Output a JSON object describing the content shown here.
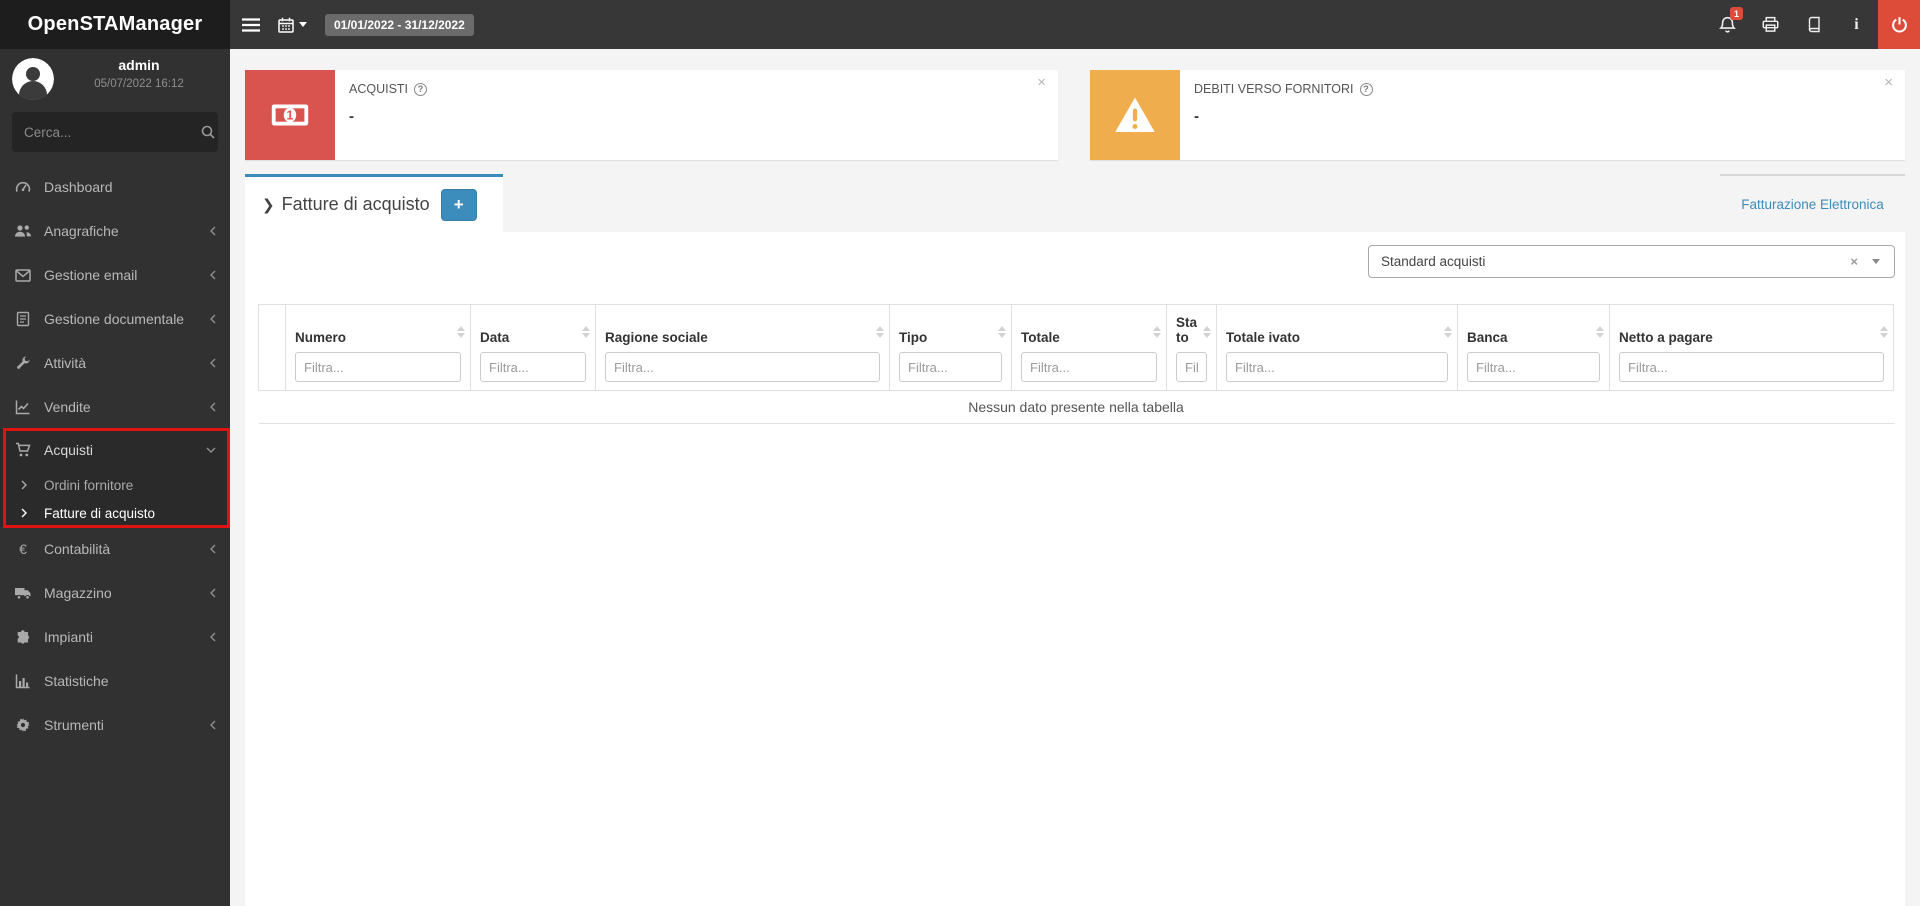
{
  "app": {
    "title": "OpenSTAManager"
  },
  "topbar": {
    "date_range": "01/01/2022 - 31/12/2022",
    "notification_count": "1"
  },
  "user": {
    "name": "admin",
    "datetime": "05/07/2022 16:12"
  },
  "search": {
    "placeholder": "Cerca..."
  },
  "sidebar": {
    "items": [
      {
        "label": "Dashboard",
        "icon": "dashboard-icon",
        "chevron": "none"
      },
      {
        "label": "Anagrafiche",
        "icon": "users-icon",
        "chevron": "collapsed"
      },
      {
        "label": "Gestione email",
        "icon": "envelope-icon",
        "chevron": "collapsed"
      },
      {
        "label": "Gestione documentale",
        "icon": "document-icon",
        "chevron": "collapsed"
      },
      {
        "label": "Attività",
        "icon": "wrench-icon",
        "chevron": "collapsed"
      },
      {
        "label": "Vendite",
        "icon": "chart-line-icon",
        "chevron": "collapsed"
      },
      {
        "label": "Acquisti",
        "icon": "cart-icon",
        "chevron": "expanded",
        "highlighted": true,
        "children": [
          {
            "label": "Ordini fornitore",
            "active": false
          },
          {
            "label": "Fatture di acquisto",
            "active": true
          }
        ]
      },
      {
        "label": "Contabilità",
        "icon": "euro-icon",
        "chevron": "collapsed"
      },
      {
        "label": "Magazzino",
        "icon": "truck-icon",
        "chevron": "collapsed"
      },
      {
        "label": "Impianti",
        "icon": "puzzle-icon",
        "chevron": "collapsed"
      },
      {
        "label": "Statistiche",
        "icon": "bar-chart-icon",
        "chevron": "none"
      },
      {
        "label": "Strumenti",
        "icon": "gear-icon",
        "chevron": "collapsed"
      }
    ]
  },
  "infoboxes": [
    {
      "label": "ACQUISTI",
      "value": "-",
      "icon": "money-bill-icon",
      "color": "#d9534f"
    },
    {
      "label": "DEBITI VERSO FORNITORI",
      "value": "-",
      "icon": "warning-icon",
      "color": "#f0ad4e"
    }
  ],
  "tabs": {
    "active": "Fatture di acquisto",
    "add_button": "+",
    "right_link": "Fatturazione Elettronica"
  },
  "filter_select": {
    "value": "Standard acquisti"
  },
  "table": {
    "columns": [
      {
        "label": "",
        "placeholder": ""
      },
      {
        "label": "Numero",
        "placeholder": "Filtra..."
      },
      {
        "label": "Data",
        "placeholder": "Filtra..."
      },
      {
        "label": "Ragione sociale",
        "placeholder": "Filtra..."
      },
      {
        "label": "Tipo",
        "placeholder": "Filtra..."
      },
      {
        "label": "Totale",
        "placeholder": "Filtra..."
      },
      {
        "label": "Stato",
        "placeholder": "Filtra..."
      },
      {
        "label": "Totale ivato",
        "placeholder": "Filtra..."
      },
      {
        "label": "Banca",
        "placeholder": "Filtra..."
      },
      {
        "label": "Netto a pagare",
        "placeholder": "Filtra..."
      }
    ],
    "empty_message": "Nessun dato presente nella tabella"
  },
  "icons": {
    "hamburger-icon": "☰",
    "calendar-icon": "▦ calendar grid",
    "caret-down-icon": "▾",
    "bell-icon": "bell outline",
    "printer-icon": "printer outline",
    "book-icon": "book outline",
    "info-icon": "i",
    "power-icon": "power symbol",
    "avatar-icon": "person silhouette",
    "search-icon": "magnifier",
    "euro-icon": "€",
    "chevron-collapsed": "‹",
    "chevron-expanded": "⌄",
    "chevron-sub": "›",
    "breadcrumb-chevron": "❯",
    "close": "×",
    "clear": "×",
    "help": "?",
    "sort": "▲▼"
  },
  "colors": {
    "accent_blue": "#3c8dbc",
    "danger_red": "#d9534f",
    "warning_orange": "#f0ad4e",
    "power_red": "#dd4b39",
    "highlight_red": "#e01212",
    "topbar": "#373737",
    "sidebar": "#313131"
  }
}
